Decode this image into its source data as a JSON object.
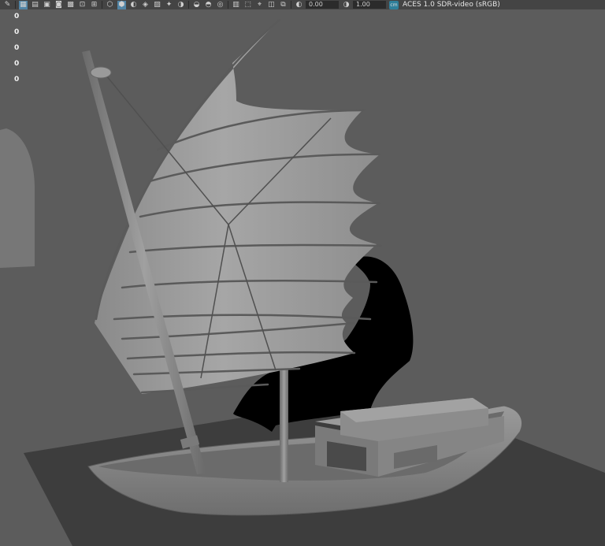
{
  "toolbar": {
    "icons": [
      {
        "name": "pencil-icon",
        "glyph": "✎"
      },
      {
        "name": "grid-icon",
        "glyph": "▦",
        "active": true
      },
      {
        "name": "film-gate-icon",
        "glyph": "▤"
      },
      {
        "name": "resolution-gate-icon",
        "glyph": "▣"
      },
      {
        "name": "gate-mask-icon",
        "glyph": "◙"
      },
      {
        "name": "field-chart-icon",
        "glyph": "▩"
      },
      {
        "name": "safe-action-icon",
        "glyph": "⊡"
      },
      {
        "name": "safe-title-icon",
        "glyph": "⊞"
      },
      {
        "name": "wireframe-icon",
        "glyph": "⬡"
      },
      {
        "name": "smooth-shade-icon",
        "glyph": "⬢",
        "active": true
      },
      {
        "name": "default-material-icon",
        "glyph": "◐"
      },
      {
        "name": "wireframe-on-shaded-icon",
        "glyph": "◈"
      },
      {
        "name": "textured-icon",
        "glyph": "▨"
      },
      {
        "name": "lights-icon",
        "glyph": "✦"
      },
      {
        "name": "shadows-icon",
        "glyph": "◑"
      },
      {
        "name": "ambient-occlusion-icon",
        "glyph": "◒"
      },
      {
        "name": "motion-blur-icon",
        "glyph": "◓"
      },
      {
        "name": "anti-alias-icon",
        "glyph": "◎"
      },
      {
        "name": "isolate-select-icon",
        "glyph": "▥"
      },
      {
        "name": "xray-icon",
        "glyph": "⬚"
      },
      {
        "name": "xray-joints-icon",
        "glyph": "⌖"
      },
      {
        "name": "xray-components-icon",
        "glyph": "◫"
      },
      {
        "name": "backface-cull-icon",
        "glyph": "⧉"
      }
    ],
    "exposure_icon": "exposure-icon",
    "exposure_value": "0.00",
    "gamma_icon": "gamma-icon",
    "gamma_value": "1.00",
    "color_mgmt_badge": "cm",
    "color_space_label": "ACES 1.0 SDR-video (sRGB)"
  },
  "hud": {
    "values": [
      "0",
      "0",
      "0",
      "0",
      "0"
    ]
  },
  "colors": {
    "toolbar_bg": "#444444",
    "viewport_bg": "#5c5c5c",
    "ground": "#3c3c3c",
    "sail": "#9a9a9a",
    "hull": "#8c8c8c",
    "shadow": "#000000",
    "accent": "#5285a6"
  }
}
